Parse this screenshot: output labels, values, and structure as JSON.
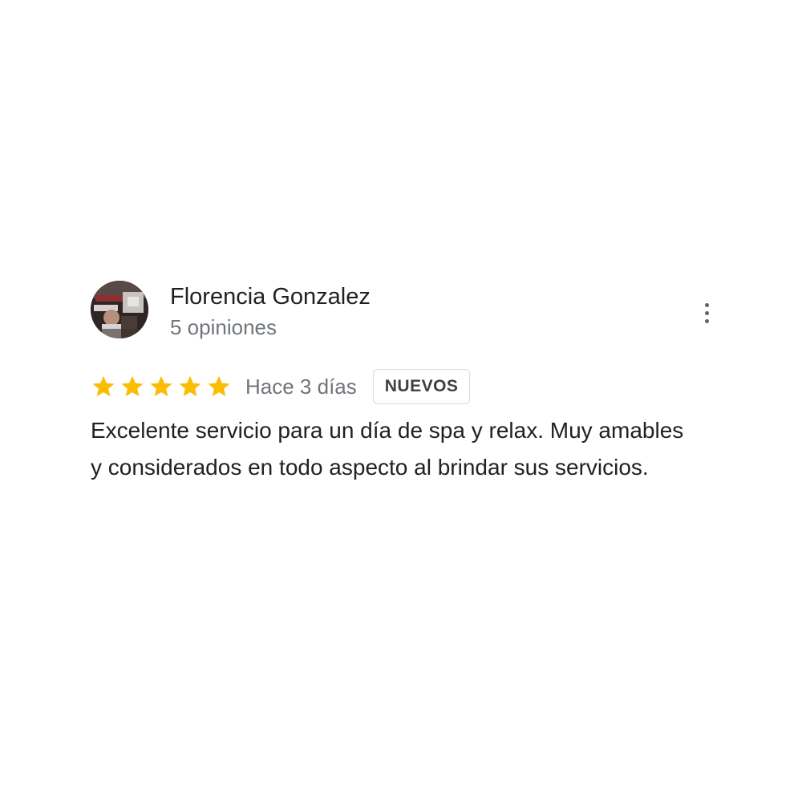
{
  "review": {
    "author_name": "Florencia Gonzalez",
    "author_meta": "5 opiniones",
    "rating": 5,
    "rating_max": 5,
    "date": "Hace 3 días",
    "badge": "NUEVOS",
    "text": "Excelente servicio para un día de spa y relax. Muy amables y considerados en todo aspecto al brindar sus servicios."
  },
  "icons": {
    "star": "star-icon",
    "more": "more-vert-icon",
    "avatar": "user-avatar-photo"
  },
  "colors": {
    "star": "#fbbc04",
    "text_primary": "#202124",
    "text_secondary": "#70757a",
    "badge_border": "#dadce0"
  }
}
